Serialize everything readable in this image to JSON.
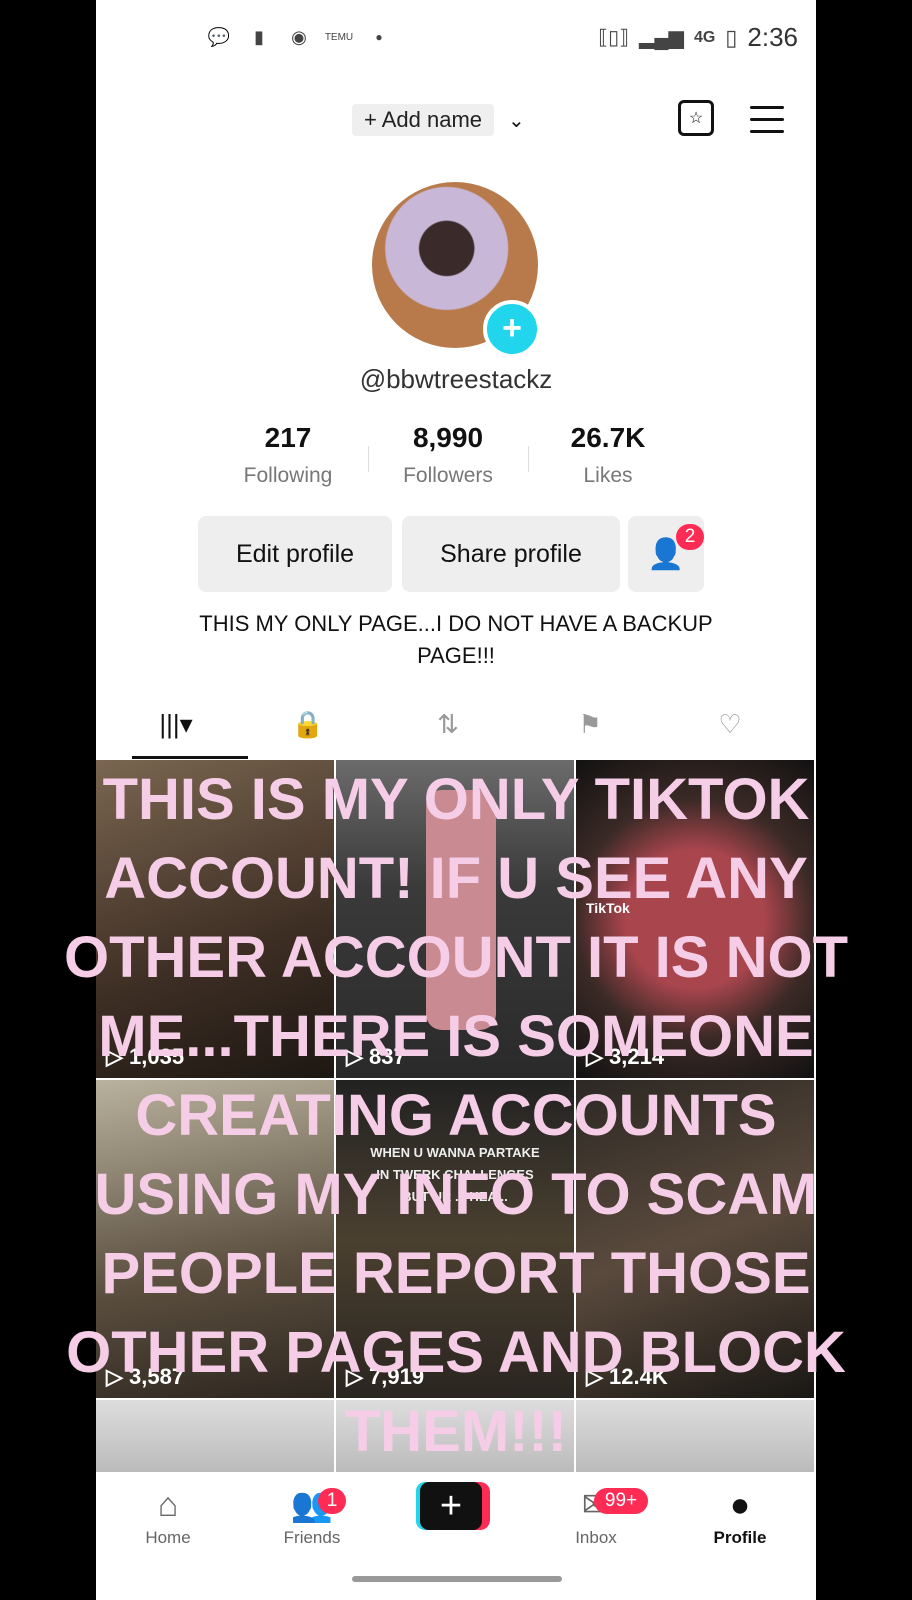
{
  "status": {
    "time": "2:36",
    "network": "4G",
    "icons": [
      "chat-icon",
      "battery-alert-icon",
      "messenger-icon",
      "temu-icon",
      "dot-icon"
    ]
  },
  "topbar": {
    "add_name": "+ Add name",
    "chevron": "⌄"
  },
  "profile": {
    "handle": "@bbwtreestackz"
  },
  "stats": [
    {
      "value": "217",
      "label": "Following"
    },
    {
      "value": "8,990",
      "label": "Followers"
    },
    {
      "value": "26.7K",
      "label": "Likes"
    }
  ],
  "actions": {
    "edit": "Edit profile",
    "share": "Share profile",
    "friends_badge": "2"
  },
  "bio": "THIS MY ONLY PAGE...I DO NOT HAVE A BACKUP PAGE!!!",
  "grid": {
    "views": [
      "1,035",
      "837",
      "3,214",
      "3,587",
      "7,919",
      "12.4K"
    ],
    "captions": [
      "WHEN U WANNA PARTAKE",
      "IN TWERK CHALLENGES",
      "BUT UR ... HEA..."
    ],
    "watermark": "TikTok"
  },
  "overlay_text": "THIS IS MY ONLY TIKTOK ACCOUNT! IF U SEE ANY OTHER ACCOUNT IT IS NOT ME...THERE IS SOMEONE CREATING ACCOUNTS USING MY INFO TO SCAM PEOPLE REPORT THOSE OTHER PAGES AND BLOCK THEM!!!",
  "nav": {
    "home": "Home",
    "friends": "Friends",
    "friends_badge": "1",
    "inbox": "Inbox",
    "inbox_badge": "99+",
    "profile": "Profile"
  },
  "colors": {
    "accent_red": "#fe2c55",
    "accent_cyan": "#20d5ec",
    "overlay_pink": "#f6cde6"
  }
}
